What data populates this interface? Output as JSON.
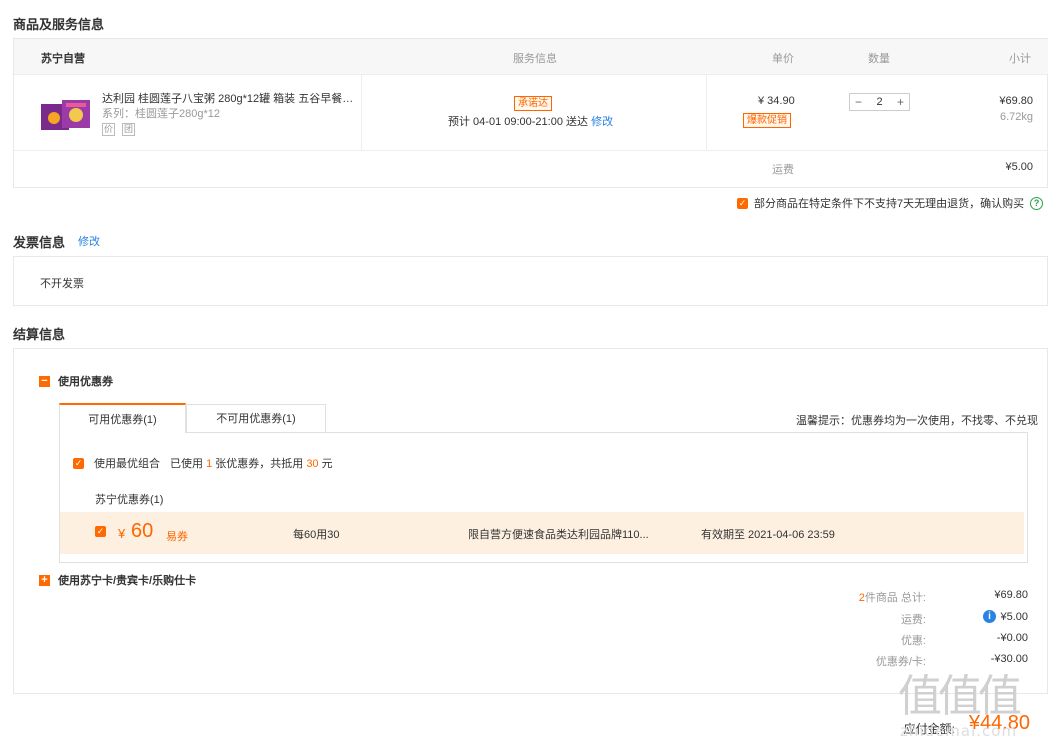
{
  "goods": {
    "title": "商品及服务信息",
    "headers": {
      "store": "苏宁自营",
      "service": "服务信息",
      "price": "单价",
      "qty": "数量",
      "subtotal": "小计"
    },
    "item": {
      "name": "达利园 桂圆莲子八宝粥 280g*12罐 箱装 五谷早餐…",
      "series": "系列：桂圆莲子280g*12",
      "badge1": "价",
      "badge2": "团",
      "promise": "承诺达",
      "delivery": "预计 04-01  09:00-21:00  送达",
      "modify": "修改",
      "price": "¥ 34.90",
      "promo": "爆款促销",
      "quantity": "2",
      "minus": "−",
      "plus": "+",
      "subtotal": "¥69.80",
      "weight": "6.72kg"
    },
    "shipping_label": "运费",
    "shipping_value": "¥5.00",
    "return_notice": "部分商品在特定条件下不支持7天无理由退货，确认购买",
    "help": "?"
  },
  "invoice": {
    "title": "发票信息",
    "modify": "修改",
    "value": "不开发票"
  },
  "settle": {
    "title": "结算信息",
    "coupon_toggle_icon": "−",
    "coupon_toggle": "使用优惠券",
    "tab_available": "可用优惠券(1)",
    "tab_unavailable": "不可用优惠券(1)",
    "tip": "温馨提示：优惠券均为一次使用，不找零、不兑现",
    "best_combo_label": "使用最优组合",
    "best_combo_pre": "已使用",
    "best_combo_count": "1",
    "best_combo_mid": "张优惠券，共抵用",
    "best_combo_amount": "30",
    "best_combo_unit": "元",
    "coupon_group": "苏宁优惠券(1)",
    "coupon": {
      "symbol": "¥",
      "amount": "60",
      "type": "易券",
      "rule": "每60用30",
      "scope": "限自营方便速食品类达利园品牌110...",
      "expiry": "有效期至 2021-04-06 23:59"
    },
    "card_toggle_icon": "+",
    "card_toggle": "使用苏宁卡/贵宾卡/乐购仕卡",
    "summary": {
      "count": "2",
      "count_label": "件商品 总计:",
      "total": "¥69.80",
      "shipping_label": "运费:",
      "shipping": "¥5.00",
      "discount_label": "优惠:",
      "discount": "-¥0.00",
      "coupon_label": "优惠券/卡:",
      "coupon": "-¥30.00",
      "pay_label": "应付金额:",
      "pay": "¥44.80"
    }
  },
  "watermark": {
    "logo": "值值值",
    "url": "zhidemai.com"
  },
  "colors": {
    "accent": "#ff6a00",
    "link": "#2a82e4",
    "border": "#e8e8e8"
  }
}
